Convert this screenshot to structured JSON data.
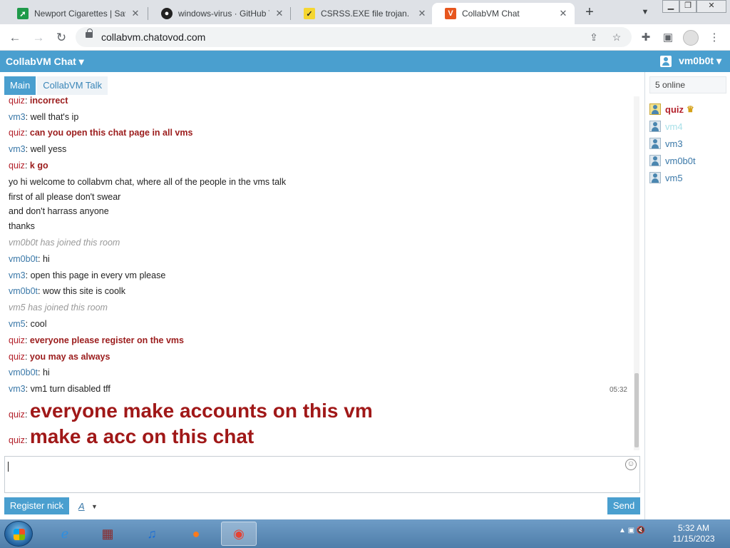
{
  "browser": {
    "tabs": [
      {
        "title": "Newport Cigarettes | Save",
        "icon": "newport-icon"
      },
      {
        "title": "windows-virus · GitHub To",
        "icon": "github-icon"
      },
      {
        "title": "CSRSS.EXE file trojan. | N",
        "icon": "checkmark-icon"
      },
      {
        "title": "CollabVM Chat",
        "icon": "collabvm-icon",
        "active": true
      }
    ],
    "url": "collabvm.chatovod.com"
  },
  "app": {
    "title": "CollabVM Chat ▾",
    "username": "vm0b0t ▾"
  },
  "rooms": {
    "main": "Main",
    "talk": "CollabVM Talk"
  },
  "messages": [
    {
      "nick": "quiz",
      "text": "incorrect"
    },
    {
      "nick": "vm3",
      "text": "well that's ip"
    },
    {
      "nick": "quiz",
      "text": "can you open this chat page in all vms"
    },
    {
      "nick": "vm3",
      "text": "well yess"
    },
    {
      "nick": "quiz",
      "text": "k go"
    },
    {
      "text": "yo hi welcome to collabvm chat, where all of the people in the vms talk"
    },
    {
      "text": "first of all please don't swear"
    },
    {
      "text": "and don't harrass anyone"
    },
    {
      "text": "thanks"
    },
    {
      "system": "vm0b0t has joined this room"
    },
    {
      "nick": "vm0b0t",
      "text": "hi"
    },
    {
      "nick": "vm3",
      "text": "open this page in every vm please"
    },
    {
      "nick": "vm0b0t",
      "text": "wow this site is coolk"
    },
    {
      "system": "vm5 has joined this room"
    },
    {
      "nick": "vm5",
      "text": "cool"
    },
    {
      "nick": "quiz",
      "text": "everyone please register on the vms"
    },
    {
      "nick": "quiz",
      "text": "you may as always"
    },
    {
      "nick": "vm0b0t",
      "text": "hi"
    },
    {
      "nick": "vm3",
      "text": "vm1 turn disabled tff",
      "time": "05:32"
    },
    {
      "nick": "quiz",
      "text": "everyone make accounts on this vm"
    },
    {
      "nick": "quiz",
      "text": "make a acc on this chat"
    }
  ],
  "composer": {
    "register": "Register nick",
    "font": "A",
    "send": "Send"
  },
  "sidebar": {
    "online": "5 online",
    "users": [
      "quiz",
      "vm4",
      "vm3",
      "vm0b0t",
      "vm5"
    ]
  },
  "taskbar": {
    "time": "5:32 AM",
    "date": "11/15/2023"
  },
  "colors": {
    "accent": "#4a9fcf",
    "nick": "#3a78a8",
    "moderator": "#b3202a"
  }
}
